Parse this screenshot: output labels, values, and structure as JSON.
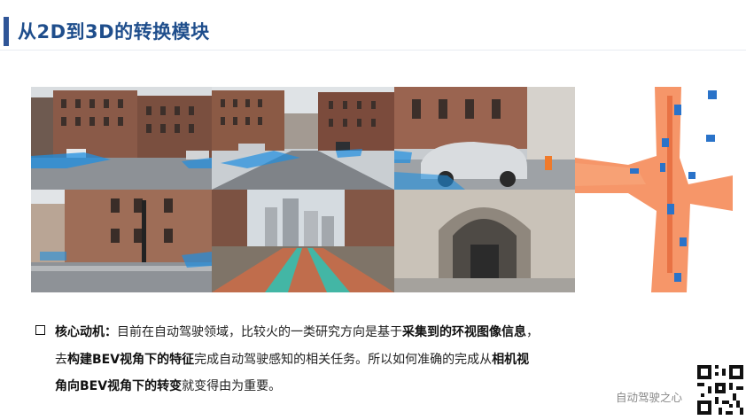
{
  "slide": {
    "title": "从2D到3D的转换模块"
  },
  "figure": {
    "cameras": [
      {
        "name": "front-left-camera"
      },
      {
        "name": "front-camera"
      },
      {
        "name": "front-right-camera"
      },
      {
        "name": "back-left-camera"
      },
      {
        "name": "back-camera"
      },
      {
        "name": "back-right-camera"
      }
    ],
    "bev_colors": {
      "road": "#f4844f",
      "vehicle": "#2a73c9",
      "background": "#ffffff"
    },
    "overlay_color": "#1f8fe0"
  },
  "bullet": {
    "label": "核心动机：",
    "line1_a": "目前在自动驾驶领域，比较火的一类研究方向是基于",
    "line1_b": "采集到的环视图像信息",
    "line1_c": "，",
    "line2_a": "去",
    "line2_b": "构建BEV视角下的特征",
    "line2_c": "完成自动驾驶感知的相关任务。所以如何准确的完成从",
    "line2_d": "相机视",
    "line3_a": "角向BEV视角下的转变",
    "line3_b": "就变得由为重要。"
  },
  "footer": {
    "watermark": "自动驾驶之心"
  }
}
